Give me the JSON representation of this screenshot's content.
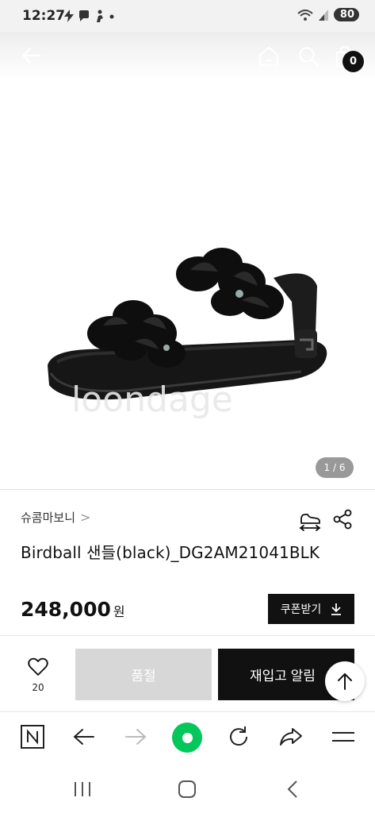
{
  "status_bar": {
    "time": "12:27",
    "battery": "80",
    "icons": [
      "lightning-icon",
      "chat-icon",
      "person-icon",
      "dot-icon",
      "wifi-icon",
      "signal-icon"
    ]
  },
  "nav": {
    "cart_count": "0",
    "icons": [
      "back-arrow-icon",
      "home-icon",
      "search-icon",
      "bag-icon"
    ]
  },
  "gallery": {
    "counter": "1 / 6",
    "watermark": "loondage"
  },
  "product": {
    "brand": "슈콤마보니",
    "brand_chevron": ">",
    "title": "Birdball 샌들(black)_DG2AM21041BLK",
    "price": "248,000",
    "price_unit": "원",
    "coupon_label": "쿠폰받기"
  },
  "purchase_bar": {
    "like_count": "20",
    "soldout_label": "품절",
    "restock_label": "재입고 알림"
  },
  "browser_bar": {
    "icons": [
      "naver-n-icon",
      "back-icon",
      "forward-icon",
      "green-home-icon",
      "reload-icon",
      "share-icon",
      "menu-icon"
    ]
  },
  "system_nav": {
    "icons": [
      "recent-apps-icon",
      "home-button-icon",
      "back-button-icon"
    ]
  },
  "colors": {
    "accent_green": "#03c75a",
    "dark": "#111111",
    "soldout_gray": "#d7d7d7"
  }
}
